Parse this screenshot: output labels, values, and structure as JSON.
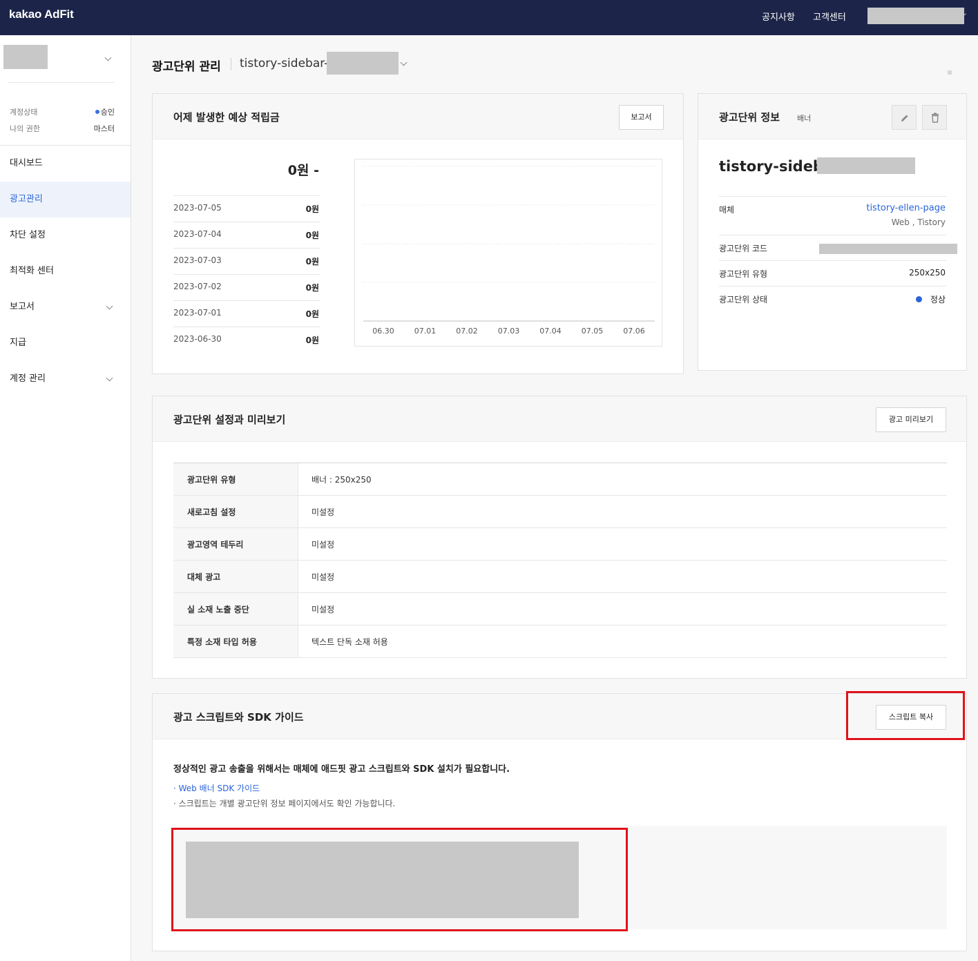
{
  "header": {
    "logo": "kakao AdFit",
    "nav": [
      "공지사항",
      "고객센터"
    ]
  },
  "sidebar": {
    "account_status_label": "계정상태",
    "account_status_value": "승인",
    "role_label": "나의 권한",
    "role_value": "마스터",
    "items": [
      {
        "label": "대시보드"
      },
      {
        "label": "광고관리"
      },
      {
        "label": "차단 설정"
      },
      {
        "label": "최적화 센터"
      },
      {
        "label": "보고서"
      },
      {
        "label": "지급"
      },
      {
        "label": "계정 관리"
      }
    ]
  },
  "page": {
    "title": "광고단위 관리",
    "unit_name": "tistory-sidebar-"
  },
  "earnings": {
    "title": "어제 발생한 예상 적립금",
    "report_button": "보고서",
    "total": "0원 -",
    "rows": [
      {
        "date": "2023-07-05",
        "value": "0원"
      },
      {
        "date": "2023-07-04",
        "value": "0원"
      },
      {
        "date": "2023-07-03",
        "value": "0원"
      },
      {
        "date": "2023-07-02",
        "value": "0원"
      },
      {
        "date": "2023-07-01",
        "value": "0원"
      },
      {
        "date": "2023-06-30",
        "value": "0원"
      }
    ]
  },
  "chart_data": {
    "type": "line",
    "categories": [
      "06.30",
      "07.01",
      "07.02",
      "07.03",
      "07.04",
      "07.05",
      "07.06"
    ],
    "series": [
      {
        "values": [
          0,
          0,
          0,
          0,
          0,
          0,
          0
        ]
      }
    ],
    "title": "",
    "xlabel": "",
    "ylabel": "",
    "grid": true
  },
  "info": {
    "title": "광고단위 정보",
    "type_badge": "배너",
    "unit_name": "tistory-sidebar",
    "media_label": "매체",
    "media_value": "tistory-ellen-page",
    "media_sub": "Web , Tistory",
    "code_label": "광고단위 코드",
    "type_label": "광고단위 유형",
    "type_value": "250x250",
    "state_label": "광고단위 상태",
    "state_value": "정상"
  },
  "settings": {
    "title": "광고단위 설정과 미리보기",
    "preview_button": "광고 미리보기",
    "rows": [
      {
        "label": "광고단위 유형",
        "value": "배너 : 250x250"
      },
      {
        "label": "새로고침 설정",
        "value": "미설정"
      },
      {
        "label": "광고영역 테두리",
        "value": "미설정"
      },
      {
        "label": "대체 광고",
        "value": "미설정"
      },
      {
        "label": "실 소재 노출 중단",
        "value": "미설정"
      },
      {
        "label": "특정 소재 타입 허용",
        "value": "텍스트 단독 소재 허용"
      }
    ]
  },
  "script": {
    "title": "광고 스크립트와 SDK 가이드",
    "copy_button": "스크립트 복사",
    "notice": "정상적인 광고 송출을 위해서는 매체에 애드핏 광고 스크립트와 SDK 설치가 필요합니다.",
    "guide_link": "· Web 배너 SDK 가이드",
    "note": "· 스크립트는 개별 광고단위 정보 페이지에서도 확인 가능합니다."
  }
}
